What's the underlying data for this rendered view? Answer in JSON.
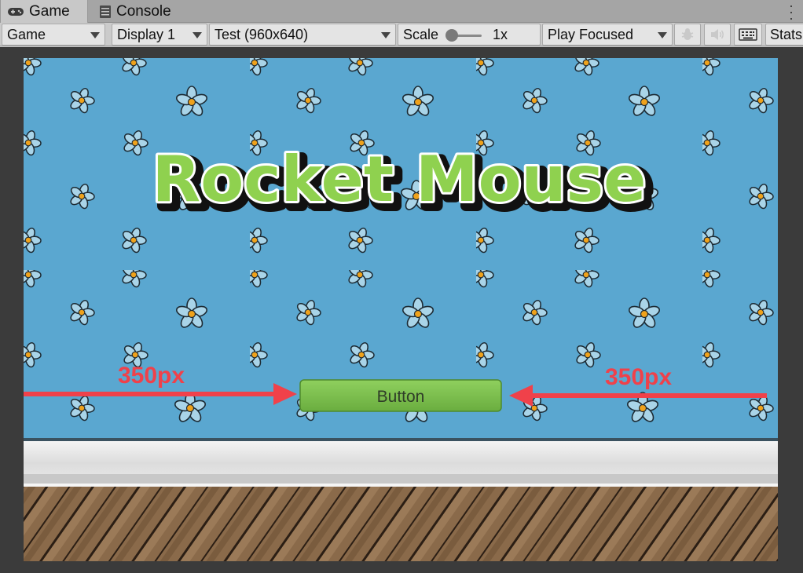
{
  "tabs": [
    {
      "label": "Game",
      "icon": "gamepad-icon",
      "active": true
    },
    {
      "label": "Console",
      "icon": "console-icon",
      "active": false
    }
  ],
  "toolbar": {
    "view_select": "Game",
    "display_select": "Display 1",
    "resolution_select": "Test (960x640)",
    "scale_label": "Scale",
    "scale_value": "1x",
    "scale_level": 0.1,
    "play_mode_select": "Play Focused",
    "stats_label": "Stats"
  },
  "game": {
    "title": "Rocket Mouse",
    "button_label": "Button",
    "left_annotation": "350px",
    "right_annotation": "350px"
  },
  "colors": {
    "background_blue": "#5aa7d0",
    "title_green": "#8fd14f",
    "button_green": "#7cc04e",
    "annotation_red": "#f0414a",
    "floor_brown": "#8a6a4a"
  }
}
